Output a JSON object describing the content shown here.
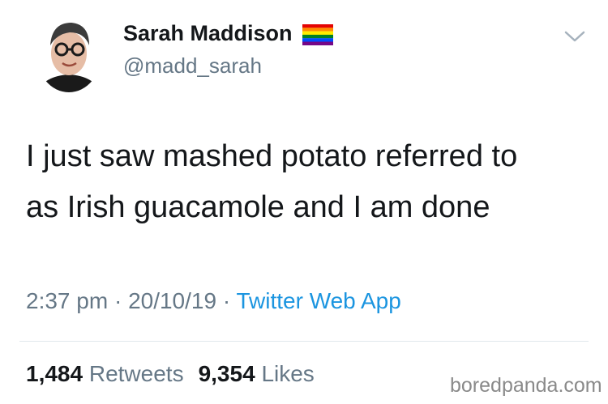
{
  "tweet": {
    "author": {
      "name": "Sarah Maddison",
      "handle": "@madd_sarah",
      "name_emoji": "rainbow-flag-icon"
    },
    "text_lines": [
      "I just saw mashed potato referred to",
      "as Irish guacamole and I am done"
    ],
    "time": "2:37 pm",
    "separator": "·",
    "date": "20/10/19",
    "source": "Twitter Web App",
    "retweets": {
      "count": "1,484",
      "label": "Retweets"
    },
    "likes": {
      "count": "9,354",
      "label": "Likes"
    }
  },
  "watermark": "boredpanda.com",
  "colors": {
    "text_primary": "#14171a",
    "text_secondary": "#657786",
    "link": "#1b95e0",
    "divider": "#e1e8ed"
  }
}
